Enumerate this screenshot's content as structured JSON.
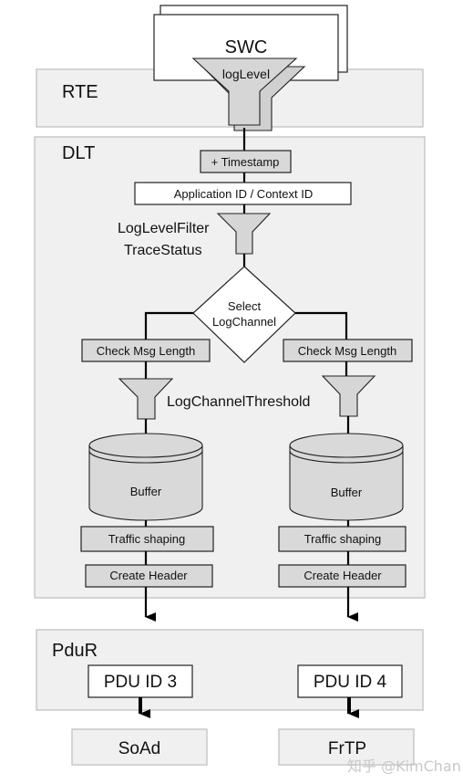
{
  "layers": {
    "rte": "RTE",
    "dlt": "DLT",
    "pdur": "PduR"
  },
  "swc": {
    "label": "SWC",
    "filter_label": "logLevel"
  },
  "dlt": {
    "timestamp": "+ Timestamp",
    "app_context_id": "Application ID / Context ID",
    "filter_label_1": "LogLevelFilter",
    "filter_label_2": "TraceStatus",
    "decision_line_1": "Select",
    "decision_line_2": "LogChannel",
    "threshold_label": "LogChannelThreshold",
    "channels": [
      {
        "check": "Check Msg Length",
        "buffer": "Buffer",
        "traffic": "Traffic shaping",
        "header": "Create Header"
      },
      {
        "check": "Check Msg Length",
        "buffer": "Buffer",
        "traffic": "Traffic shaping",
        "header": "Create Header"
      }
    ]
  },
  "pdur": {
    "pdus": [
      "PDU ID 3",
      "PDU ID 4"
    ]
  },
  "destinations": [
    "SoAd",
    "FrTP"
  ],
  "watermark": "知乎 @KimChan"
}
